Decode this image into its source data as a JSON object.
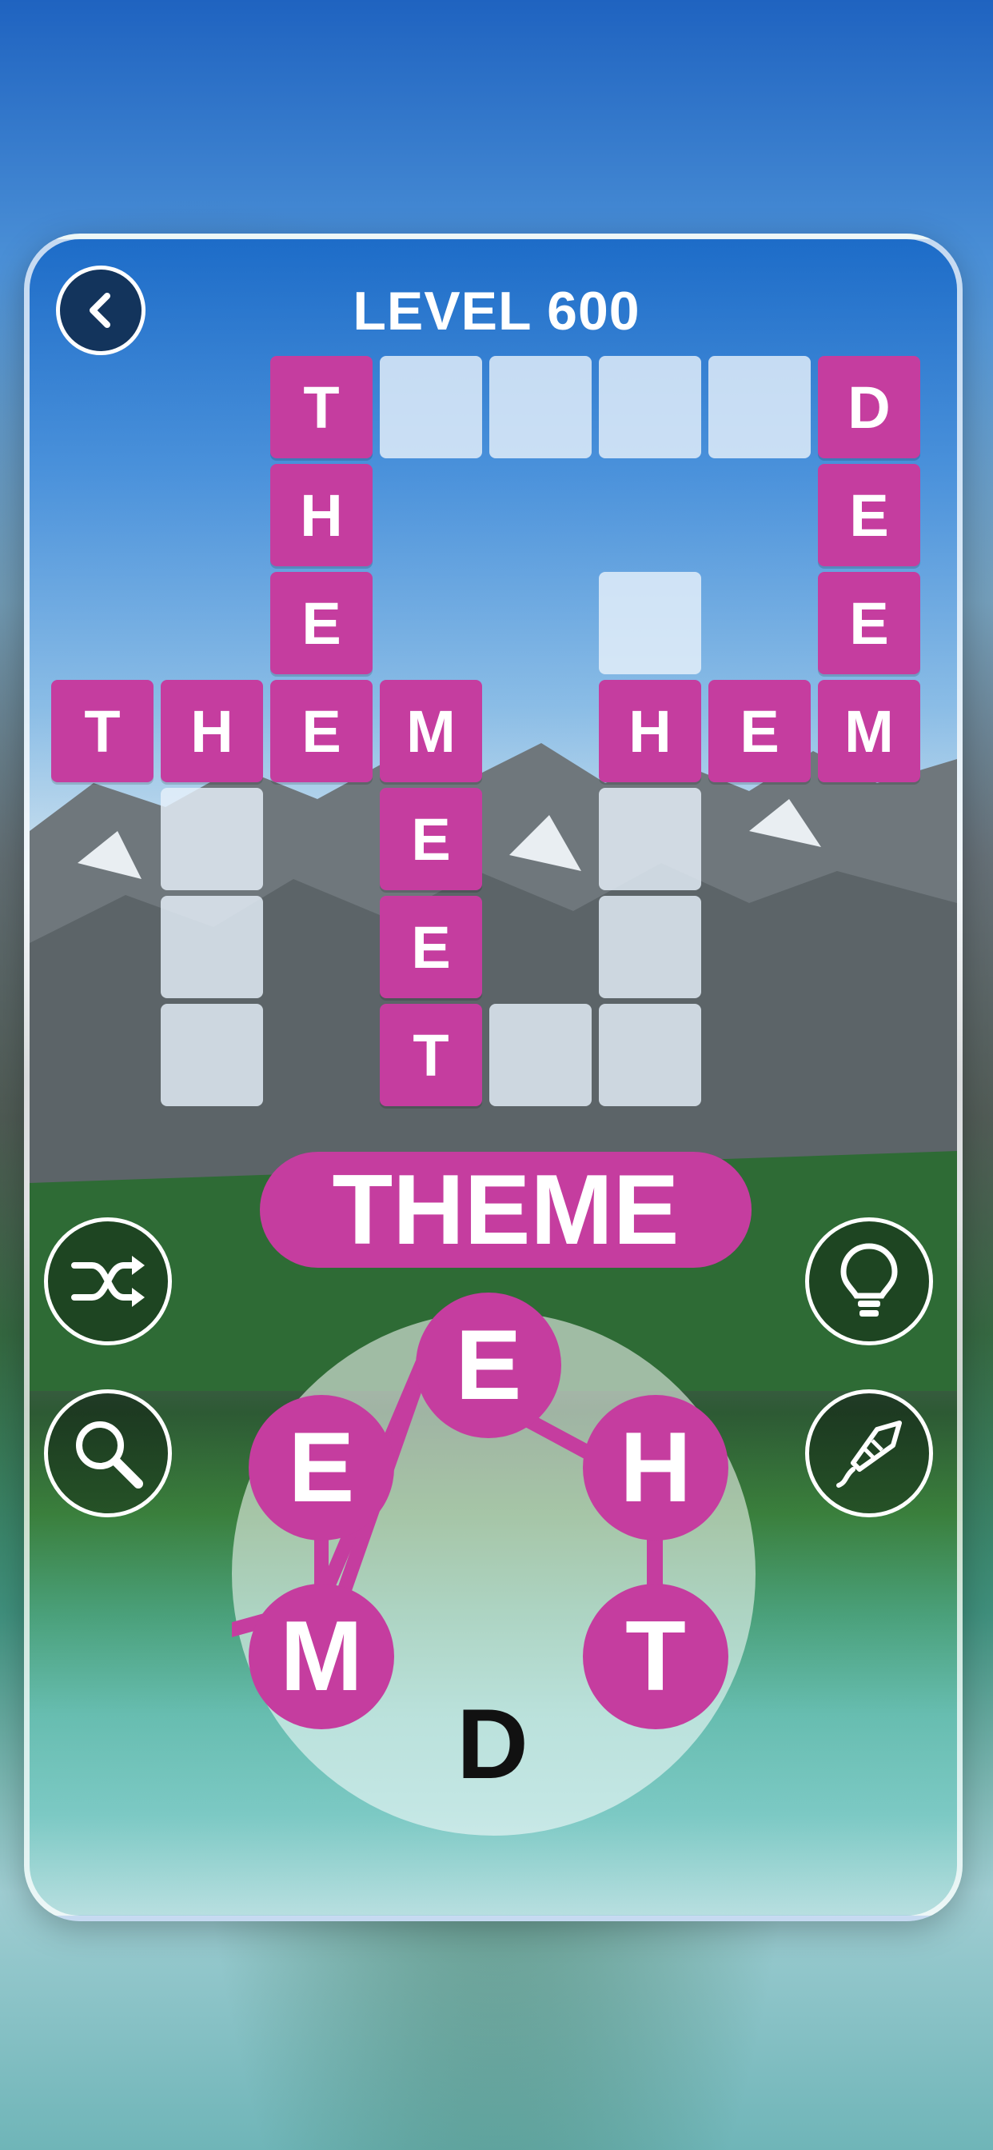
{
  "header": {
    "level": "LEVEL 600"
  },
  "grid": {
    "tiles": [
      {
        "letter": "T",
        "state": "filled"
      },
      {
        "letter": "",
        "state": "empty"
      },
      {
        "letter": "",
        "state": "empty"
      },
      {
        "letter": "",
        "state": "empty"
      },
      {
        "letter": "",
        "state": "empty"
      },
      {
        "letter": "D",
        "state": "filled"
      },
      {
        "letter": "H",
        "state": "filled"
      },
      {
        "letter": "E",
        "state": "filled"
      },
      {
        "letter": "E",
        "state": "filled"
      },
      {
        "letter": "",
        "state": "empty"
      },
      {
        "letter": "E",
        "state": "filled"
      },
      {
        "letter": "T",
        "state": "filled"
      },
      {
        "letter": "H",
        "state": "filled"
      },
      {
        "letter": "E",
        "state": "filled"
      },
      {
        "letter": "M",
        "state": "filled"
      },
      {
        "letter": "H",
        "state": "filled"
      },
      {
        "letter": "E",
        "state": "filled"
      },
      {
        "letter": "M",
        "state": "filled"
      },
      {
        "letter": "",
        "state": "empty"
      },
      {
        "letter": "E",
        "state": "filled"
      },
      {
        "letter": "",
        "state": "empty"
      },
      {
        "letter": "",
        "state": "empty"
      },
      {
        "letter": "E",
        "state": "filled"
      },
      {
        "letter": "",
        "state": "empty"
      },
      {
        "letter": "",
        "state": "empty"
      },
      {
        "letter": "T",
        "state": "filled"
      },
      {
        "letter": "",
        "state": "empty"
      },
      {
        "letter": "",
        "state": "empty"
      }
    ]
  },
  "current_word": "THEME",
  "wheel": {
    "letters": [
      {
        "letter": "E",
        "state": "selected"
      },
      {
        "letter": "E",
        "state": "selected"
      },
      {
        "letter": "H",
        "state": "selected"
      },
      {
        "letter": "M",
        "state": "selected"
      },
      {
        "letter": "T",
        "state": "selected"
      },
      {
        "letter": "D",
        "state": "unselected"
      }
    ]
  },
  "buttons": {
    "back": "back-arrow-icon",
    "shuffle": "shuffle-icon",
    "search": "magnifier-icon",
    "hint": "lightbulb-icon",
    "rocket": "rocket-icon"
  },
  "colors": {
    "tile_filled": "#c53d9f",
    "tile_empty": "#e6f0fa",
    "back_button": "#13345c"
  }
}
